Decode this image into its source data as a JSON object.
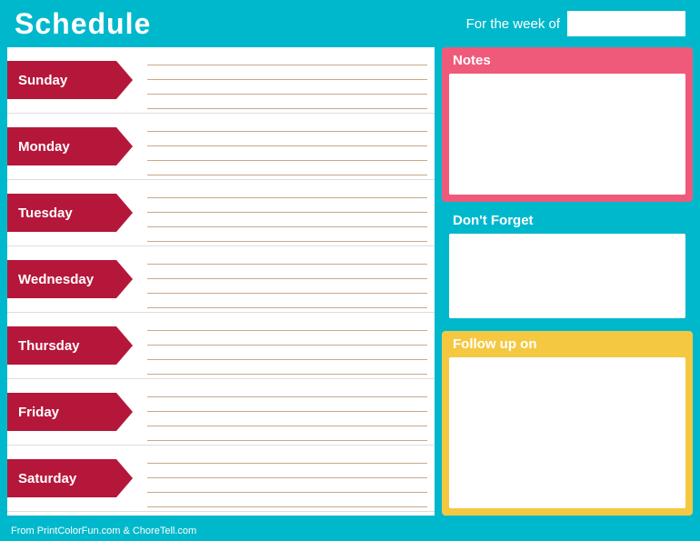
{
  "header": {
    "title": "Schedule",
    "week_label": "For the week of",
    "week_input_placeholder": ""
  },
  "days": [
    {
      "name": "Sunday",
      "lines": 4
    },
    {
      "name": "Monday",
      "lines": 4
    },
    {
      "name": "Tuesday",
      "lines": 4
    },
    {
      "name": "Wednesday",
      "lines": 4
    },
    {
      "name": "Thursday",
      "lines": 4
    },
    {
      "name": "Friday",
      "lines": 4
    },
    {
      "name": "Saturday",
      "lines": 4
    }
  ],
  "notes_box": {
    "title": "Notes"
  },
  "dont_forget_box": {
    "title": "Don't Forget"
  },
  "follow_up_box": {
    "title": "Follow up on"
  },
  "footer": {
    "text": "From PrintColorFun.com & ChoreTell.com"
  }
}
